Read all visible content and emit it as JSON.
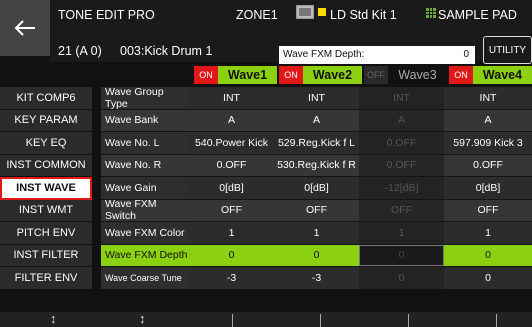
{
  "header": {
    "title": "TONE EDIT PRO",
    "zone": "ZONE1",
    "kit_name": "LD Std Kit 1",
    "sample_pad": "SAMPLE PAD",
    "note_number": "21 (A 0)",
    "instrument": "003:Kick Drum 1",
    "param_label": "Wave FXM Depth:",
    "param_value": "0",
    "utility": "UTILITY"
  },
  "waves": [
    {
      "state": "ON",
      "name": "Wave1",
      "active": true
    },
    {
      "state": "ON",
      "name": "Wave2",
      "active": true
    },
    {
      "state": "OFF",
      "name": "Wave3",
      "active": false
    },
    {
      "state": "ON",
      "name": "Wave4",
      "active": true
    }
  ],
  "menu": [
    "KIT COMP6",
    "KEY PARAM",
    "KEY EQ",
    "INST COMMON",
    "INST WAVE",
    "INST WMT",
    "PITCH ENV",
    "INST FILTER",
    "FILTER ENV"
  ],
  "selected_menu": "INST WAVE",
  "rows": [
    {
      "label": "Wave Group Type",
      "values": [
        "INT",
        "INT",
        "INT",
        "INT"
      ]
    },
    {
      "label": "Wave Bank",
      "values": [
        "A",
        "A",
        "A",
        "A"
      ]
    },
    {
      "label": "Wave No. L",
      "values": [
        "540.Power Kick",
        "529.Reg.Kick f L",
        "0.OFF",
        "597.909 Kick 3"
      ]
    },
    {
      "label": "Wave No. R",
      "values": [
        "0.OFF",
        "530.Reg.Kick f R",
        "0.OFF",
        "0.OFF"
      ]
    },
    {
      "label": "Wave Gain",
      "values": [
        "0[dB]",
        "0[dB]",
        "-12[dB]",
        "0[dB]"
      ]
    },
    {
      "label": "Wave FXM Switch",
      "values": [
        "OFF",
        "OFF",
        "OFF",
        "OFF"
      ]
    },
    {
      "label": "Wave FXM Color",
      "values": [
        "1",
        "1",
        "1",
        "1"
      ]
    },
    {
      "label": "Wave FXM Depth",
      "values": [
        "0",
        "0",
        "0",
        "0"
      ]
    },
    {
      "label": "Wave Coarse Tune",
      "values": [
        "-3",
        "-3",
        "0",
        "0"
      ]
    }
  ],
  "colors": {
    "accent_green": "#8cd10f",
    "on_red": "#e01818",
    "kit_yellow": "#ffdd00"
  },
  "icons": {
    "back": "back-arrow-icon",
    "kit": "kit-image-icon",
    "pad": "grid-pad-icon",
    "knob": "up-down-arrow-icon"
  }
}
